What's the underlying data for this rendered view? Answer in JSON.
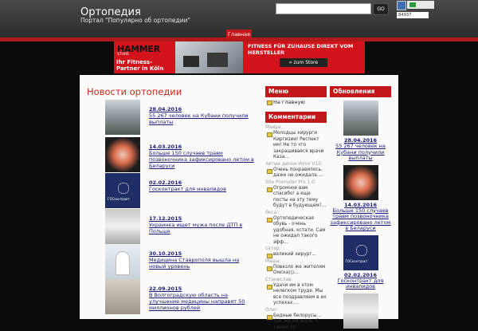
{
  "header": {
    "site_title": "Ортопедия",
    "site_subtitle": "Портал \"Популярно об ортопедии\"",
    "search_placeholder": "",
    "search_button": "GO",
    "counter_value": "84937"
  },
  "nav": {
    "tabs": [
      {
        "label": "Главная"
      }
    ]
  },
  "ad": {
    "brand": "HAMMER",
    "brand_sub": "STORE",
    "tagline": "Ihr Fitness-Partner in Köln",
    "headline": "FITNESS FÜR ZUHAUSE DIREKT VOM HERSTELLER",
    "cta": "» zum Store"
  },
  "main": {
    "title": "Новости ортопедии",
    "posts": [
      {
        "date": "28.04.2016",
        "title": "55 267 человек на Кубани получили выплаты"
      },
      {
        "date": "14.03.2016",
        "title": "Больше 150 случаев травм позвоночника зафиксировано летом в Беларуси"
      },
      {
        "date": "02.02.2016",
        "title": "Госконтракт для инвалидов"
      },
      {
        "date": "17.12.2015",
        "title": "Украинка ищет мужа после ДТП в Польше"
      },
      {
        "date": "30.10.2015",
        "title": "Медицина Ставрополя вышла на новый уровень"
      },
      {
        "date": "22.09.2015",
        "title": "В Волгоградскую область на улучшение медицины направят 50 миллионов рублей"
      }
    ]
  },
  "menu": {
    "title": "Меню",
    "items": [
      {
        "label": "На главную"
      }
    ]
  },
  "comments": {
    "title": "Комментарии",
    "items": [
      {
        "author": "Маира:",
        "text": "Молодцы хирурги Киргизии! Респект им! Не то что закрашиваеся врачи Каза..."
      },
      {
        "author": "литые диски Volvo V13:",
        "text": "Очень понравилось, даже не ожидала...."
      },
      {
        "author": "Site Promoter Pro 1.0:",
        "text": "Огромное вам спасибо! а еще посты на эту тему будут в будующем?..."
      },
      {
        "author": "Якса:",
        "text": "Ортопедическая обувь - очень удобная, кстати. Сам не ожидал такого эфф..."
      },
      {
        "author": "сатар:",
        "text": "великий хирург..."
      },
      {
        "author": "Маша:",
        "text": "Повезло же жителям Омска)))..."
      },
      {
        "author": "Станислав:",
        "text": "Удачи им в этом нелегком труде. Мы все поздравляем в их успехах...."
      },
      {
        "author": "Олег:",
        "text": "Бедные белорусы... Как же им жаль. С таким-то"
      }
    ]
  },
  "updates": {
    "title": "Обновления",
    "items": [
      {
        "date": "28.04.2016",
        "title": "55 267 человек на Кубани получили выплаты"
      },
      {
        "date": "14.03.2016",
        "title": "Больше 150 случаев травм позвоночника зафиксировано летом в Беларуси"
      },
      {
        "date": "02.02.2016",
        "title": "Госконтракт для инвалидов"
      }
    ]
  }
}
